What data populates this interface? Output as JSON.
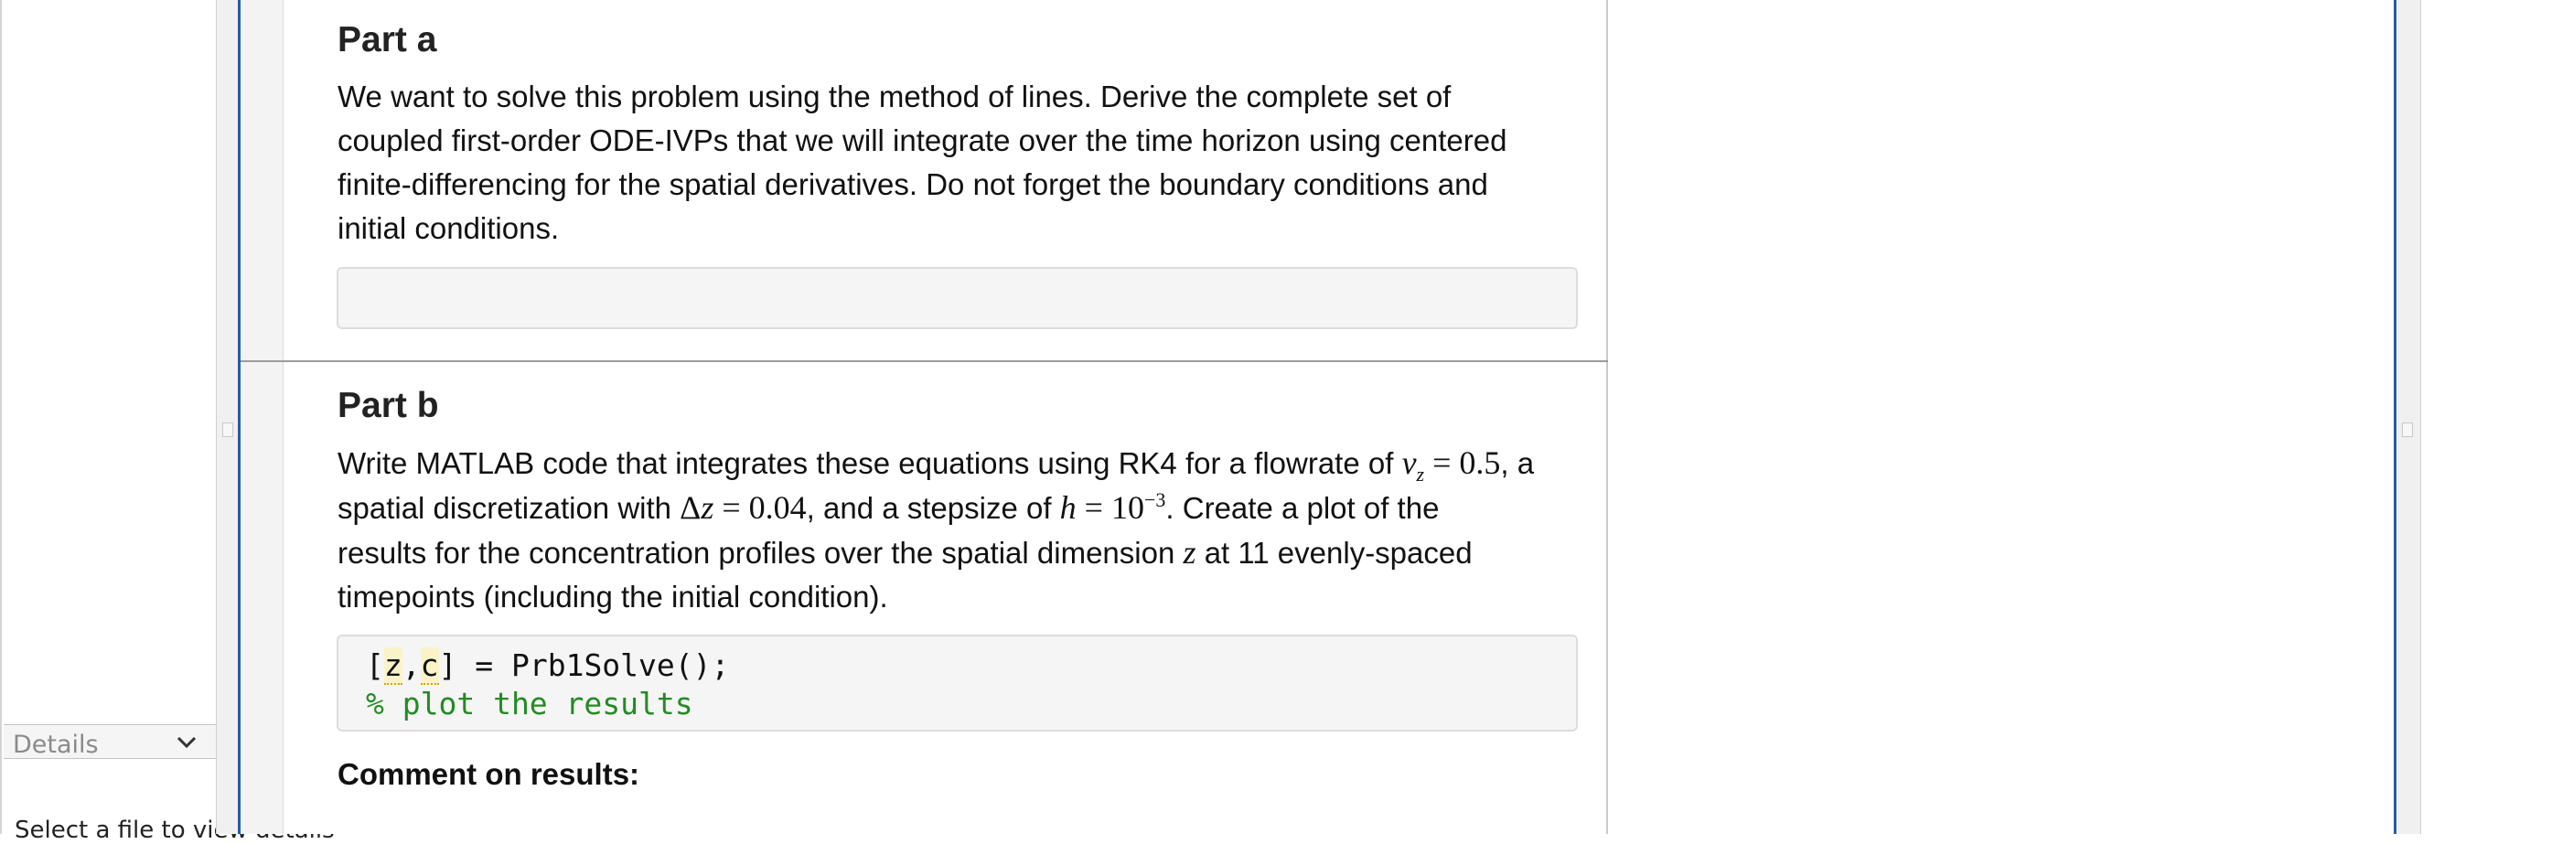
{
  "sidebar": {
    "details_label": "Details",
    "select_file_message": "Select a file to view details"
  },
  "part_a": {
    "heading": "Part a",
    "lines": [
      "We want to solve this problem using the method of lines.  Derive the complete set of",
      "coupled first-order ODE-IVPs that we will integrate over the time horizon using centered",
      "finite-differencing for the spatial derivatives. Do not forget the boundary conditions and",
      "initial conditions."
    ]
  },
  "part_b": {
    "heading": "Part b",
    "line1_a": "Write MATLAB code that integrates these equations using RK4 for a flowrate of",
    "line1_math": "= 0.5",
    "line1_b": ", a",
    "line2_a": "spatial discretization with",
    "line2_math": "= 0.04",
    "line2_b": ", and a stepsize of",
    "line2_math2": "= 10",
    "line2_exp": "−3",
    "line2_c": ". Create a plot of the",
    "line3_a": "results for the concentration profiles over the spatial dimension",
    "line3_b": "at 11 evenly-spaced",
    "line4": "timepoints (including the initial condition).",
    "code": {
      "line1_prefix": "[",
      "var_z": "z",
      "comma": ",",
      "var_c": "c",
      "line1_suffix": "] = Prb1Solve();",
      "line2": "% plot the results"
    },
    "comment_heading": "Comment on results:"
  },
  "colors": {
    "frame_accent": "#2a5aa6",
    "comment_green": "#228b22"
  }
}
